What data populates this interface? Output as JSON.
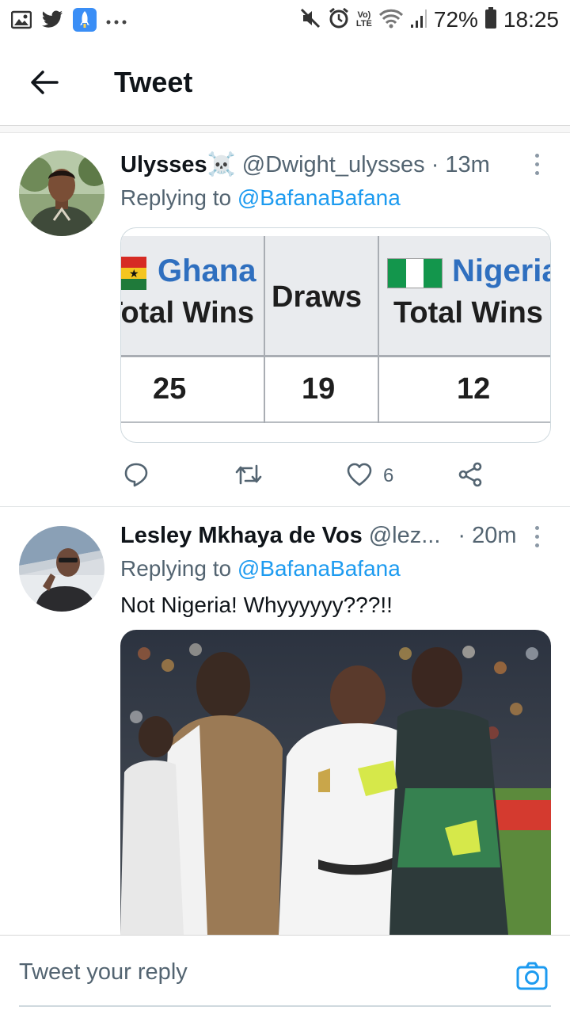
{
  "status_bar": {
    "battery_percent": "72%",
    "time": "18:25",
    "volte_top": "Vo)",
    "volte_bottom": "LTE",
    "left_icons": [
      "gallery-icon",
      "twitter-icon",
      "rocket-app-icon",
      "more-notifications-icon"
    ],
    "right_icons": [
      "mute-icon",
      "alarm-icon",
      "volte-icon",
      "wifi-icon",
      "signal-icon",
      "battery-icon"
    ]
  },
  "header": {
    "title": "Tweet",
    "back_icon": "arrow-left-icon"
  },
  "tweets": [
    {
      "name": "Ulysses☠️",
      "handle": "@Dwight_ulysses",
      "separator": "·",
      "time": "13m",
      "replying_prefix": "Replying to",
      "replying_to": "@BafanaBafana",
      "media_table": {
        "team1": "Ghana",
        "team1_label": "Total Wins",
        "draws_label": "Draws",
        "team2": "Nigeria",
        "team2_label": "Total Wins",
        "team1_wins": "25",
        "draws": "19",
        "team2_wins": "12"
      },
      "actions": {
        "reply_icon": "reply-icon",
        "retweet_icon": "retweet-icon",
        "like_icon": "heart-icon",
        "like_count": "6",
        "share_icon": "share-icon"
      }
    },
    {
      "name": "Lesley Mkhaya de Vos",
      "handle": "@lez...",
      "separator": "·",
      "time": "20m",
      "replying_prefix": "Replying to",
      "replying_to": "@BafanaBafana",
      "text": "Not Nigeria! Whyyyyyy???!!"
    }
  ],
  "reply_bar": {
    "placeholder": "Tweet your reply",
    "camera_icon": "camera-icon"
  },
  "colors": {
    "accent": "#1d9bf0",
    "text_primary": "#0f1419",
    "text_secondary": "#536471",
    "ghana_blue": "#2f6fbf"
  }
}
